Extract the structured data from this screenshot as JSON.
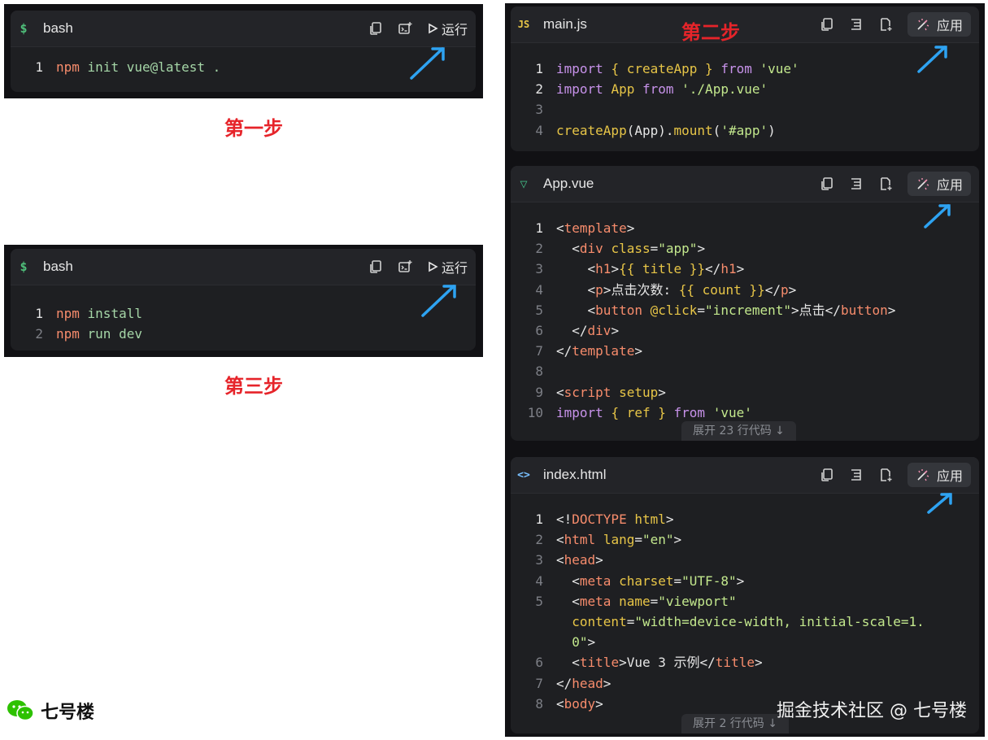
{
  "colors": {
    "step_label": "#e6242a",
    "arrow": "#2ea3f2",
    "panel_bg": "#111114",
    "card_bg": "#1e1f22"
  },
  "step1": {
    "label": "第一步",
    "card": {
      "lang_icon": "$",
      "file_name": "bash",
      "run_label": "运行",
      "lines": [
        {
          "num": "1",
          "cmd": "npm",
          "arg": " init vue@latest ."
        }
      ]
    }
  },
  "step3": {
    "label": "第三步",
    "card": {
      "lang_icon": "$",
      "file_name": "bash",
      "run_label": "运行",
      "lines": [
        {
          "num": "1",
          "cmd": "npm",
          "arg": " install"
        },
        {
          "num": "2",
          "cmd": "npm",
          "arg": " run dev"
        }
      ]
    }
  },
  "step2": {
    "label": "第二步",
    "main_js": {
      "lang_icon": "JS",
      "file_name": "main.js",
      "apply_label": "应用",
      "line_numbers": [
        "1",
        "2",
        "3",
        "4"
      ]
    },
    "app_vue": {
      "lang_icon": "▽",
      "file_name": "App.vue",
      "apply_label": "应用",
      "line_numbers": [
        "1",
        "2",
        "3",
        "4",
        "5",
        "6",
        "7",
        "8",
        "9",
        "10"
      ],
      "expand_label": "展开 23 行代码 ↓"
    },
    "index_html": {
      "lang_icon": "<>",
      "file_name": "index.html",
      "apply_label": "应用",
      "line_numbers": [
        "1",
        "2",
        "3",
        "4",
        "5",
        "",
        "",
        "6",
        "7",
        "8"
      ],
      "expand_label": "展开 2 行代码 ↓"
    }
  },
  "code_tokens": {
    "main_js": {
      "l1": [
        "import",
        " ",
        "{ createApp }",
        " ",
        "from",
        " ",
        "'vue'"
      ],
      "l2": [
        "import",
        " ",
        "App",
        " ",
        "from",
        " ",
        "'./App.vue'"
      ],
      "l4": [
        "createApp",
        "(App).",
        "mount",
        "(",
        "'#app'",
        ")"
      ]
    },
    "app_vue": {
      "l1": [
        "<",
        "template",
        ">"
      ],
      "l2": [
        "  <",
        "div",
        " ",
        "class",
        "=",
        "\"app\"",
        ">"
      ],
      "l3": [
        "    <",
        "h1",
        ">",
        "{{ title }}",
        "</",
        "h1",
        ">"
      ],
      "l4": [
        "    <",
        "p",
        ">",
        "点击次数: ",
        "{{ count }}",
        "</",
        "p",
        ">"
      ],
      "l5": [
        "    <",
        "button",
        " ",
        "@click",
        "=",
        "\"increment\"",
        ">",
        "点击",
        "</",
        "button",
        ">"
      ],
      "l6": [
        "  </",
        "div",
        ">"
      ],
      "l7": [
        "</",
        "template",
        ">"
      ],
      "l9": [
        "<",
        "script",
        " ",
        "setup",
        ">"
      ],
      "l10": [
        "import",
        " ",
        "{ ref }",
        " ",
        "from",
        " ",
        "'vue'"
      ]
    },
    "index_html": {
      "l1": [
        "<!",
        "DOCTYPE",
        " ",
        "html",
        ">"
      ],
      "l2": [
        "<",
        "html",
        " ",
        "lang",
        "=",
        "\"en\"",
        ">"
      ],
      "l3": [
        "<",
        "head",
        ">"
      ],
      "l4": [
        "  <",
        "meta",
        " ",
        "charset",
        "=",
        "\"UTF-8\"",
        ">"
      ],
      "l5": [
        "  <",
        "meta",
        " ",
        "name",
        "=",
        "\"viewport\""
      ],
      "l5b": [
        "  ",
        "content",
        "=",
        "\"width=device-width, initial-scale=1."
      ],
      "l5c": [
        "  ",
        "0\"",
        ">"
      ],
      "l6": [
        "  <",
        "title",
        ">",
        "Vue 3 示例",
        "</",
        "title",
        ">"
      ],
      "l7": [
        "</",
        "head",
        ">"
      ],
      "l8": [
        "<",
        "body",
        ">"
      ]
    }
  },
  "brand": {
    "name": "七号楼",
    "icon": "wechat-icon"
  },
  "watermark": "掘金技术社区 @ 七号楼"
}
